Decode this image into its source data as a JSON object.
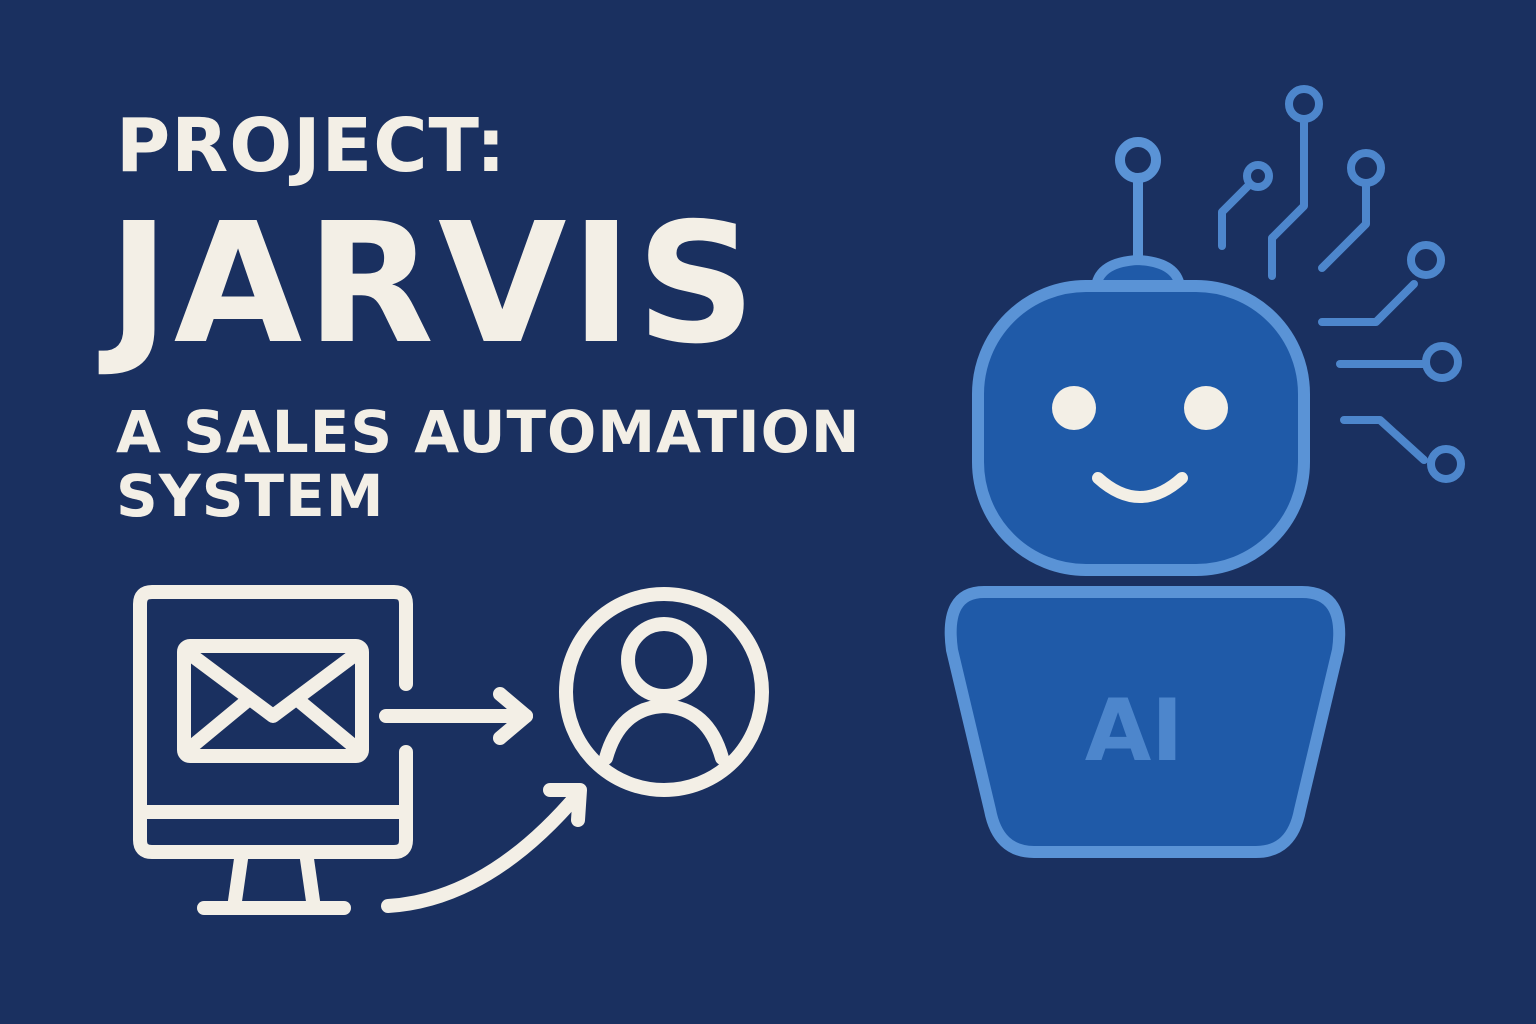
{
  "heading": {
    "kicker": "PROJECT:",
    "name": "JARVIS",
    "subtitle": "A SALES AUTOMATION SYSTEM"
  },
  "robot": {
    "chest_label": "AI"
  },
  "icons": {
    "monitor": "computer-monitor-icon",
    "email": "envelope-icon",
    "user": "user-profile-icon",
    "robot": "robot-icon",
    "circuit": "circuit-lines-icon"
  },
  "colors": {
    "background": "#1a3060",
    "text": "#f3efe6",
    "robot_fill": "#1f5aa8",
    "robot_stroke": "#5a93d6"
  }
}
